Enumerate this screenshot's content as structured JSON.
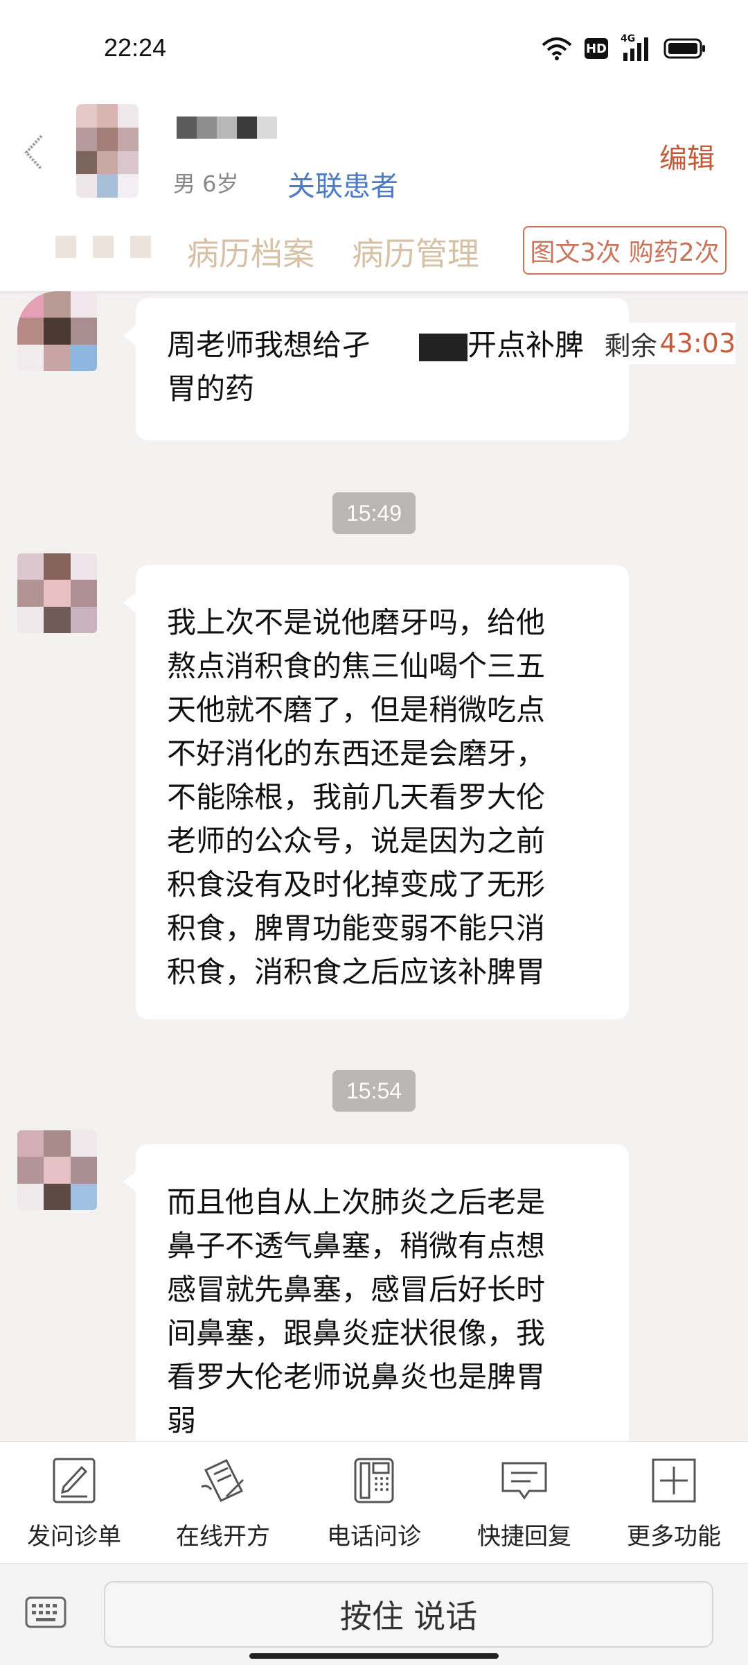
{
  "status": {
    "time": "22:24",
    "hd": "HD",
    "net": "4G"
  },
  "patient": {
    "gender_age": "男 6岁",
    "link_label": "关联患者",
    "edit_label": "编辑"
  },
  "tabs": [
    {
      "label": "病历档案"
    },
    {
      "label": "病历管理"
    }
  ],
  "badge": "图文3次 购药2次",
  "timer": {
    "label": "剩余",
    "value": "43:03"
  },
  "messages": [
    {
      "line1_a": "周老师我想给孑",
      "line1_b": "开点补脾",
      "line2": "胃的药"
    },
    {
      "time": "15:49",
      "lines": [
        "我上次不是说他磨牙吗，给他",
        "熬点消积食的焦三仙喝个三五",
        "天他就不磨了，但是稍微吃点",
        "不好消化的东西还是会磨牙，",
        "不能除根，我前几天看罗大伦",
        "老师的公众号，说是因为之前",
        "积食没有及时化掉变成了无形",
        "积食，脾胃功能变弱不能只消",
        "积食，消积食之后应该补脾胃"
      ]
    },
    {
      "time": "15:54",
      "lines": [
        "而且他自从上次肺炎之后老是",
        "鼻子不透气鼻塞，稍微有点想",
        "感冒就先鼻塞，感冒后好长时",
        "间鼻塞，跟鼻炎症状很像，我",
        "看罗大伦老师说鼻炎也是脾胃",
        "弱"
      ]
    }
  ],
  "tools": [
    {
      "label": "发问诊单",
      "icon": "questionnaire-icon"
    },
    {
      "label": "在线开方",
      "icon": "prescription-icon"
    },
    {
      "label": "电话问诊",
      "icon": "phone-icon"
    },
    {
      "label": "快捷回复",
      "icon": "quick-reply-icon"
    },
    {
      "label": "更多功能",
      "icon": "plus-icon"
    }
  ],
  "input": {
    "talk_label": "按住 说话"
  },
  "colors": {
    "accent": "#c65b3c",
    "link": "#4d7bc4",
    "tab": "#d6c1a6"
  }
}
